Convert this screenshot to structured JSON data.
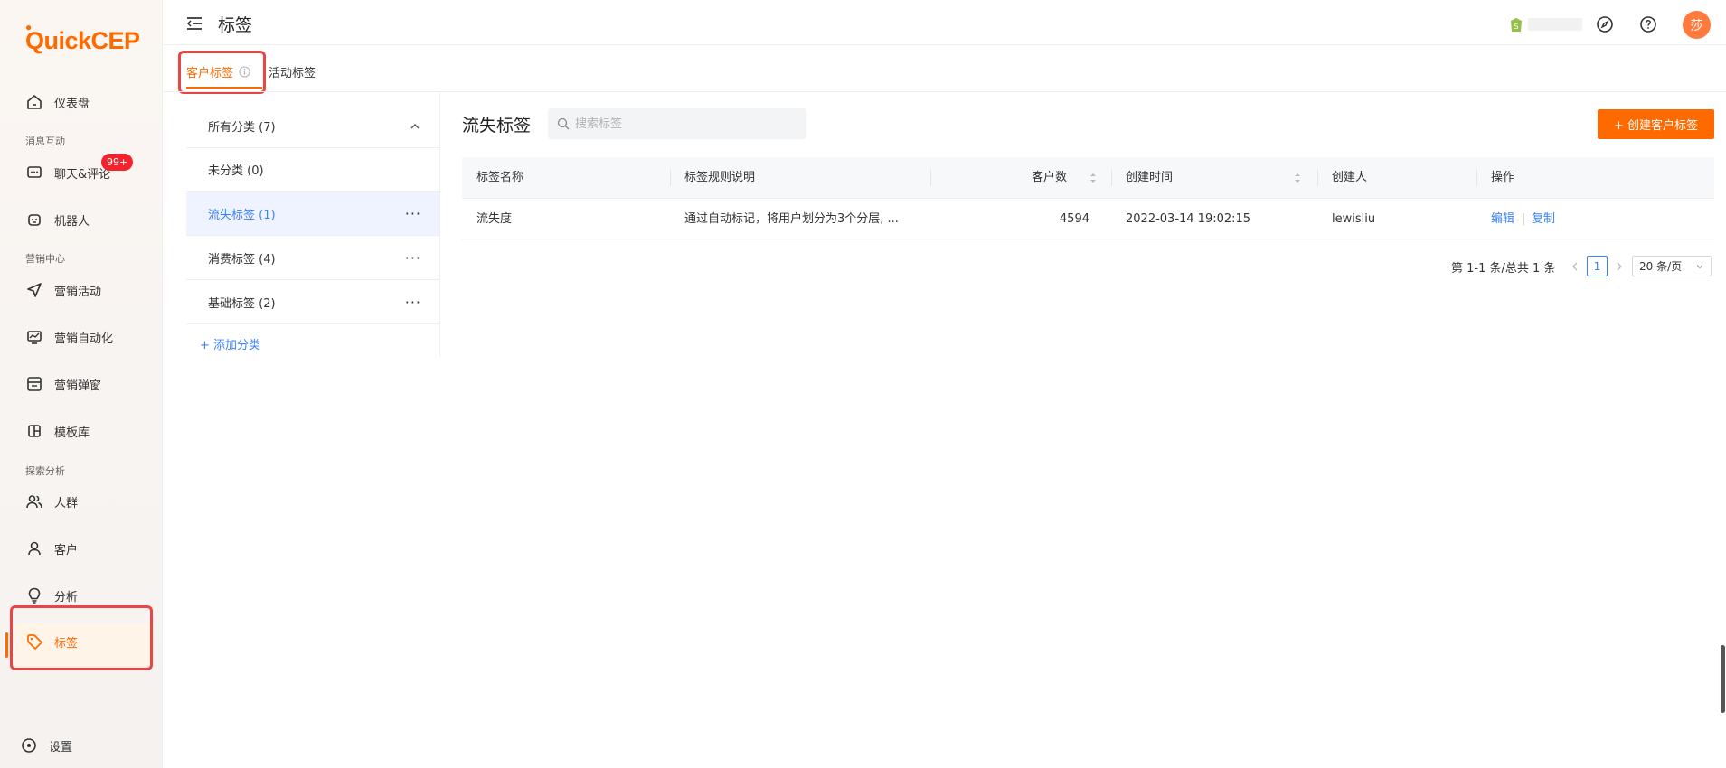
{
  "brand": {
    "logo_text": "QuickCEP",
    "accent": "#ff6a00"
  },
  "sidebar": {
    "items": [
      {
        "key": "dashboard",
        "label": "仪表盘",
        "icon": "home-icon"
      },
      {
        "key": "chat",
        "label": "聊天&评论",
        "icon": "chat-icon",
        "badge": "99+"
      },
      {
        "key": "robot",
        "label": "机器人",
        "icon": "robot-icon"
      },
      {
        "key": "campaign",
        "label": "营销活动",
        "icon": "send-icon"
      },
      {
        "key": "automation",
        "label": "营销自动化",
        "icon": "monitor-chart-icon"
      },
      {
        "key": "popup",
        "label": "营销弹窗",
        "icon": "window-icon"
      },
      {
        "key": "template",
        "label": "模板库",
        "icon": "template-icon"
      },
      {
        "key": "audience",
        "label": "人群",
        "icon": "users-icon"
      },
      {
        "key": "customer",
        "label": "客户",
        "icon": "user-icon"
      },
      {
        "key": "analysis",
        "label": "分析",
        "icon": "bulb-icon"
      },
      {
        "key": "tags",
        "label": "标签",
        "icon": "tag-icon"
      }
    ],
    "sections": {
      "messages": "消息互动",
      "marketing": "营销中心",
      "explore": "探索分析"
    },
    "settings_label": "设置"
  },
  "header": {
    "title": "标签",
    "avatar_text": "莎"
  },
  "tabs": [
    {
      "label": "客户标签",
      "active": true
    },
    {
      "label": "活动标签",
      "active": false
    }
  ],
  "categories": [
    {
      "label": "所有分类 (7)"
    },
    {
      "label": "未分类 (0)"
    },
    {
      "label": "流失标签 (1)",
      "active": true
    },
    {
      "label": "消费标签 (4)"
    },
    {
      "label": "基础标签 (2)"
    }
  ],
  "add_category_label": "+ 添加分类",
  "main": {
    "section_title": "流失标签",
    "search_placeholder": "搜索标签",
    "create_button": "+ 创建客户标签"
  },
  "table": {
    "columns": [
      "标签名称",
      "标签规则说明",
      "客户数",
      "创建时间",
      "创建人",
      "操作"
    ],
    "rows": [
      {
        "name": "流失度",
        "rule": "通过自动标记，将用户划分为3个分层, ...",
        "count": "4594",
        "created_at": "2022-03-14 19:02:15",
        "creator": "lewisliu",
        "action_edit": "编辑",
        "action_copy": "复制"
      }
    ]
  },
  "pagination": {
    "summary": "第 1-1 条/总共 1 条",
    "current_page": "1",
    "page_size": "20 条/页"
  }
}
